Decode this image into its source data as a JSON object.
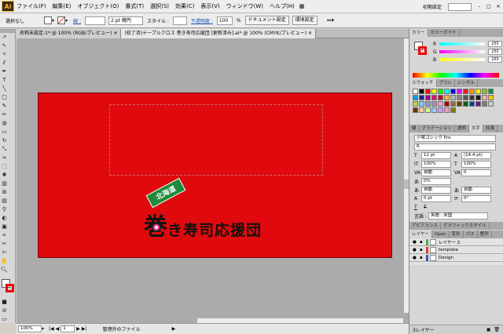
{
  "app": {
    "logo": "Ai"
  },
  "menu": [
    "ファイル(F)",
    "編集(E)",
    "オブジェクト(O)",
    "書式(T)",
    "選択(S)",
    "効果(C)",
    "表示(V)",
    "ウィンドウ(W)",
    "ヘルプ(H)"
  ],
  "workspace": "初期設定",
  "control": {
    "selection": "選択なし",
    "stroke_label": "線 :",
    "stroke_weight": "2 pt 楕円",
    "style_label": "スタイル :",
    "opacity_label": "不透明度 :",
    "opacity_value": "100",
    "opacity_unit": "%",
    "doc_setup": "ドキュメント設定",
    "preferences": "環境設定"
  },
  "tabs": [
    {
      "label": "名称未設定-1* @ 100% (RGB/プレビュー)",
      "active": false
    },
    {
      "label": "(校了済)テーブルクロス 巻き寿司応援団 [更新済み].ai* @ 100% (CMYK/プレビュー)",
      "active": true
    }
  ],
  "artwork": {
    "banner_text": "北海道",
    "logo_char": "巻",
    "logo_text": "き寿司応援団"
  },
  "status": {
    "zoom": "100%",
    "page": "1",
    "info": "管理外のファイル"
  },
  "color_panel": {
    "tabs": [
      "カラー",
      "カラーガイド"
    ],
    "channels": [
      {
        "name": "R",
        "value": "255",
        "color": "#e33"
      },
      {
        "name": "G",
        "value": "255",
        "color": "#3c3"
      },
      {
        "name": "B",
        "value": "255",
        "color": "#33e"
      }
    ]
  },
  "swatch_panel": {
    "tabs": [
      "スウォッチ",
      "ブラシ",
      "シンボル"
    ],
    "colors": [
      "#ffffff",
      "#000000",
      "#ff0000",
      "#ffff00",
      "#00ff00",
      "#00ffff",
      "#0000ff",
      "#ff00ff",
      "#e31e24",
      "#f39800",
      "#fff100",
      "#8fc31f",
      "#009944",
      "#00a0e9",
      "#1d2088",
      "#920783",
      "#e4007f",
      "#c30d23",
      "#f8b62d",
      "#b5b5b6",
      "#898989",
      "#595757",
      "#3e3a39",
      "#231815",
      "#f5b2b2",
      "#fcc800",
      "#c0d442",
      "#7ecef4",
      "#8c97cb",
      "#aa89bd",
      "#f19ec2",
      "#a40000",
      "#996c33",
      "#6a3906",
      "#005e15",
      "#004986",
      "#601986",
      "#7d7d7d",
      "#cccccc",
      "#663300",
      "#ffcc99",
      "#ccff99",
      "#99ccff",
      "#cc99ff",
      "#ff99cc",
      "#808000"
    ]
  },
  "char_panel": {
    "tabs": [
      "線",
      "グラデーション",
      "透明",
      "文字",
      "段落"
    ],
    "font": "小塚ゴシック Pro",
    "font_style": "R",
    "size": "12 pt",
    "leading": "(14.4 pt)",
    "h_scale": "100%",
    "v_scale": "100%",
    "kerning": "自動",
    "tracking": "0",
    "tsume": "0%",
    "aki_left": "自動",
    "aki_right": "自動",
    "baseline": "0 pt",
    "rotation": "0°",
    "language_label": "言語 :",
    "language": "英語 : 米国"
  },
  "appearance_tabs": [
    "アピアランス",
    "グラフィックスタイル"
  ],
  "layers_panel": {
    "tabs": [
      "レイヤー",
      "Open",
      "変形",
      "パス",
      "整列"
    ],
    "layers": [
      {
        "name": "レイヤー 3",
        "color": "#4caf50"
      },
      {
        "name": "template",
        "color": "#e53935"
      },
      {
        "name": "Design",
        "color": "#3f51b5"
      }
    ],
    "count": "3レイヤー"
  }
}
